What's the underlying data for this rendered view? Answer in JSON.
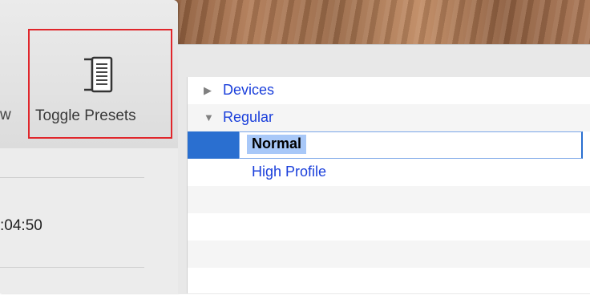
{
  "toolbar": {
    "clipped_label": "w",
    "toggle_presets_label": "Toggle Presets",
    "toggle_icon": "sidebar-toggle-icon",
    "time_value": ":04:50"
  },
  "presets": {
    "groups": [
      {
        "label": "Devices",
        "expanded": false
      },
      {
        "label": "Regular",
        "expanded": true
      }
    ],
    "items": [
      {
        "label": "Normal",
        "state": "editing"
      },
      {
        "label": "High Profile",
        "state": "normal"
      }
    ]
  },
  "colors": {
    "highlight": "#e0262b",
    "link": "#1a3fdb",
    "selection": "#2a6fd0"
  }
}
